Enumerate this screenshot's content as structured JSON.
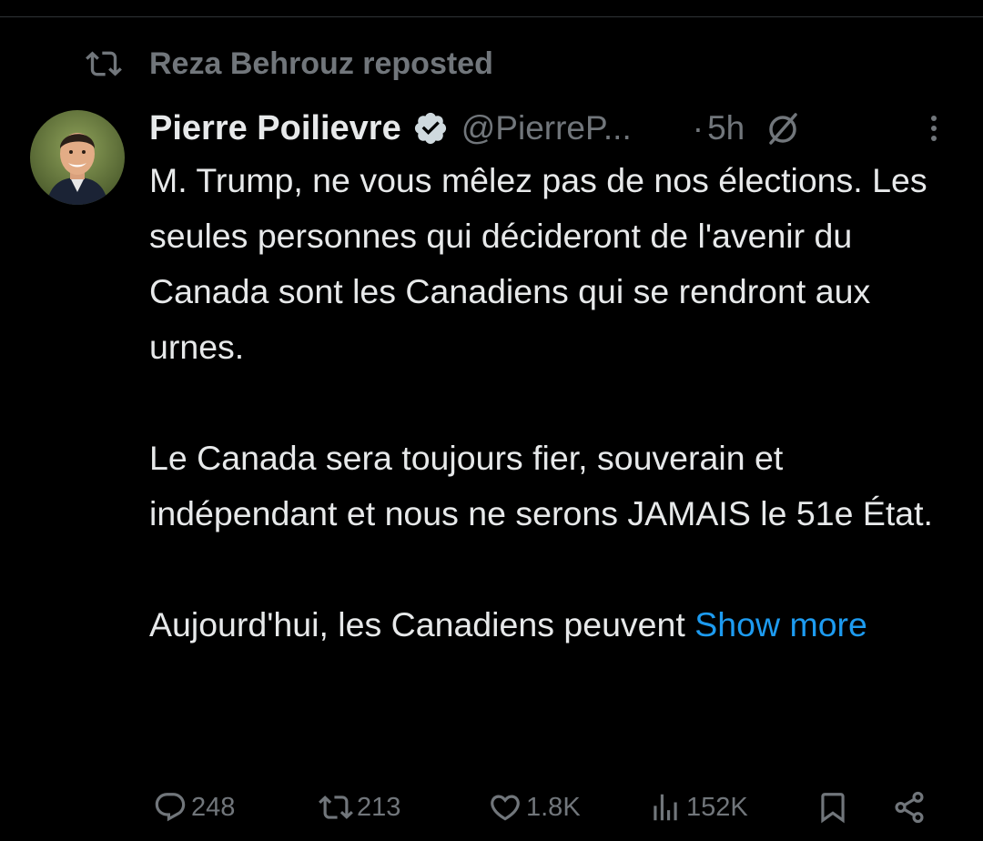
{
  "repost": {
    "icon": "repost-icon",
    "text": "Reza Behrouz reposted"
  },
  "tweet": {
    "avatar": "avatar",
    "display_name": "Pierre Poilievre",
    "verified_icon": "verified-badge-icon",
    "handle": "@PierreP...",
    "separator": "·",
    "time": "5h",
    "paragraphs": [
      "M. Trump, ne vous mêlez pas de nos élections. Les seules personnes qui décideront de l'avenir du Canada sont les Canadiens qui se rendront aux urnes.",
      "Le Canada sera toujours fier, souverain et indépendant et nous ne serons JAMAIS le 51e État.",
      "Aujourd'hui, les Canadiens peuvent "
    ],
    "show_more": "Show more"
  },
  "actions": {
    "replies": "248",
    "reposts": "213",
    "likes": "1.8K",
    "views": "152K"
  },
  "colors": {
    "background": "#000000",
    "text": "#e7e9ea",
    "muted": "#71767b",
    "link": "#1d9bf0"
  }
}
